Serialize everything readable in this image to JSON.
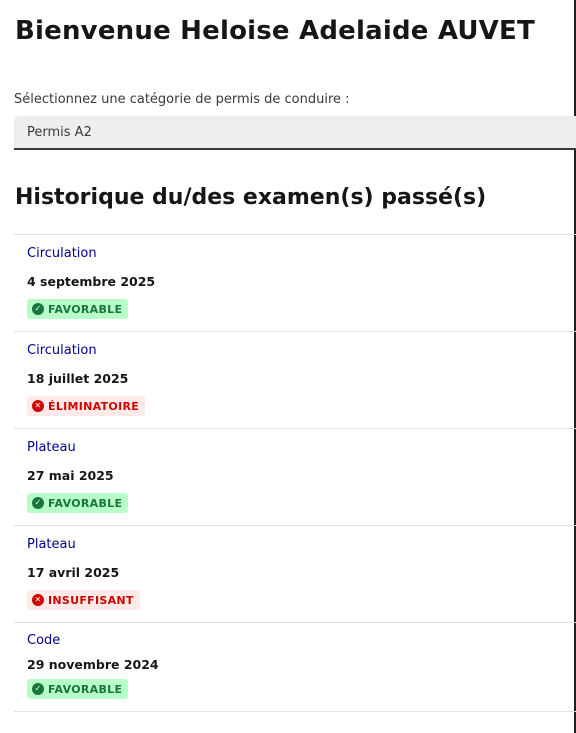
{
  "header": {
    "welcome": "Bienvenue Heloise Adelaide AUVET"
  },
  "license_select": {
    "label": "Sélectionnez une catégorie de permis de conduire :",
    "value": "Permis A2"
  },
  "history": {
    "title": "Historique du/des examen(s) passé(s)",
    "exams": [
      {
        "type": "Circulation",
        "date": "4 septembre 2025",
        "result": "FAVORABLE",
        "status": "success",
        "icon": "check-icon"
      },
      {
        "type": "Circulation",
        "date": "18 juillet 2025",
        "result": "ÉLIMINATOIRE",
        "status": "error",
        "icon": "cross-icon"
      },
      {
        "type": "Plateau",
        "date": "27 mai 2025",
        "result": "FAVORABLE",
        "status": "success",
        "icon": "check-icon"
      },
      {
        "type": "Plateau",
        "date": "17 avril 2025",
        "result": "INSUFFISANT",
        "status": "error",
        "icon": "cross-icon"
      },
      {
        "type": "Code",
        "date": "29 novembre 2024",
        "result": "FAVORABLE",
        "status": "success",
        "icon": "check-icon"
      }
    ]
  },
  "colors": {
    "link_blue": "#000091",
    "success_bg": "#b8fec9",
    "success_text": "#18753c",
    "error_bg": "#ffe9e9",
    "error_text": "#ce0500"
  }
}
